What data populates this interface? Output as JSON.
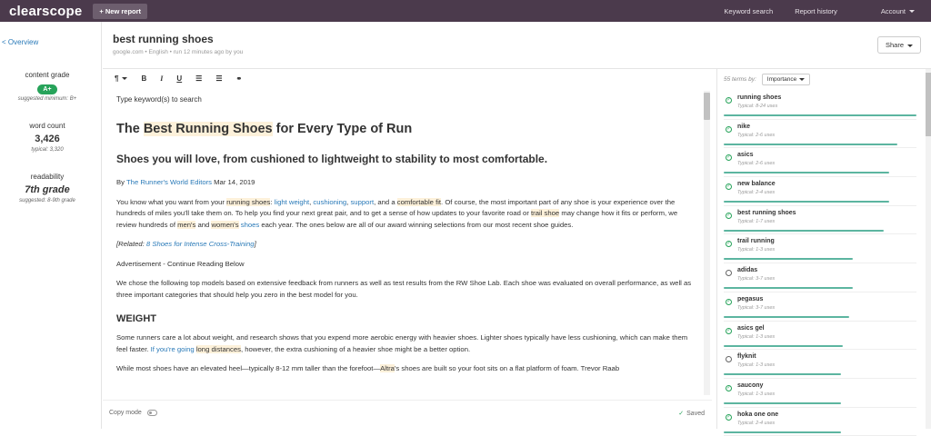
{
  "topbar": {
    "logo": "clearscope",
    "new_report": "+ New report",
    "nav": [
      "Keyword search",
      "Report history",
      "Account"
    ]
  },
  "left": {
    "overview": "< Overview",
    "content_grade_label": "content grade",
    "content_grade": "A+",
    "grade_suggested": "suggested minimum: B+",
    "word_count_label": "word count",
    "word_count": "3,426",
    "word_typical": "typical: 3,320",
    "readability_label": "readability",
    "readability": "7th grade",
    "readability_suggested": "suggested: 8-9th grade"
  },
  "doc": {
    "title": "best running shoes",
    "meta": "google.com • English • run 12 minutes ago by you",
    "share": "Share"
  },
  "toolbar": {
    "para": "¶",
    "bold": "B",
    "italic": "I",
    "underline": "U",
    "ol": "☰",
    "ul": "☰",
    "link": "⚭"
  },
  "editor": {
    "placeholder": "Type keyword(s) to search",
    "h1_pre": "The ",
    "h1_hl": "Best Running Shoes",
    "h1_post": " for Every Type of Run",
    "h2": "Shoes you will love, from cushioned to lightweight to stability to most comfortable.",
    "byline_pre": "By ",
    "byline_link": "The Runner's World Editors",
    "byline_date": " Mar 14, 2019",
    "p1_a": "You know what you want from your ",
    "p1_hl1": "running shoes",
    "p1_b": ": ",
    "p1_l1": "light weight",
    "p1_c": ", ",
    "p1_l2": "cushioning",
    "p1_d": ", ",
    "p1_l3": "support",
    "p1_e": ", and a ",
    "p1_hl2": "comfortable fit",
    "p1_f": ". Of course, the most important part of any shoe is your experience over the hundreds of miles you'll take them on. To help you find your next great pair, and to get a sense of how updates to your favorite road or ",
    "p1_hl3": "trail shoe",
    "p1_g": " may change how it fits or perform, we review hundreds of ",
    "p1_hl4": "men's",
    "p1_h": " and ",
    "p1_hl5": "women's",
    "p1_i": " ",
    "p1_l4": "shoes",
    "p1_j": " each year. The ones below are all of our award winning selections from our most recent shoe guides.",
    "related_pre": "[Related: ",
    "related_link": "8 Shoes for Intense Cross-Training",
    "related_post": "]",
    "ad": "Advertisement - Continue Reading Below",
    "p2": "We chose the following top models based on extensive feedback from runners as well as test results from the RW Shoe Lab. Each shoe was evaluated on overall performance, as well as three important categories that should help you zero in the best model for you.",
    "h3": "WEIGHT",
    "p3_a": "Some runners care a lot about weight, and research shows that you expend more aerobic energy with heavier shoes. Lighter shoes typically have less cushioning, which can make them feel faster. ",
    "p3_l1": "If you're going",
    "p3_b": " ",
    "p3_hl1": "long distances",
    "p3_c": ", however, the extra cushioning of a heavier shoe might be a better option.",
    "p4_a": "While most shoes have an elevated heel—typically 8-12 mm taller than the forefoot—",
    "p4_hl1": "Altra",
    "p4_b": "'s shoes are built so your foot sits on a flat platform of foam. Trevor Raab"
  },
  "footer": {
    "copy_mode": "Copy mode",
    "saved": "Saved"
  },
  "terms": {
    "count_label": "55 terms by:",
    "sort": "Importance",
    "items": [
      {
        "name": "running shoes",
        "typical": "Typical: 8-24 uses",
        "done": true,
        "progress": 1.0
      },
      {
        "name": "nike",
        "typical": "Typical: 2-6 uses",
        "done": true,
        "progress": 0.9
      },
      {
        "name": "asics",
        "typical": "Typical: 2-6 uses",
        "done": true,
        "progress": 0.86
      },
      {
        "name": "new balance",
        "typical": "Typical: 2-4 uses",
        "done": true,
        "progress": 0.86
      },
      {
        "name": "best running shoes",
        "typical": "Typical: 1-7 uses",
        "done": true,
        "progress": 0.83
      },
      {
        "name": "trail running",
        "typical": "Typical: 1-3 uses",
        "done": true,
        "progress": 0.67
      },
      {
        "name": "adidas",
        "typical": "Typical: 3-7 uses",
        "done": false,
        "progress": 0.67
      },
      {
        "name": "pegasus",
        "typical": "Typical: 3-7 uses",
        "done": true,
        "progress": 0.65
      },
      {
        "name": "asics gel",
        "typical": "Typical: 1-3 uses",
        "done": true,
        "progress": 0.62
      },
      {
        "name": "flyknit",
        "typical": "Typical: 1-3 uses",
        "done": false,
        "progress": 0.61
      },
      {
        "name": "saucony",
        "typical": "Typical: 1-3 uses",
        "done": true,
        "progress": 0.61
      },
      {
        "name": "hoka one one",
        "typical": "Typical: 2-4 uses",
        "done": true,
        "progress": 0.61
      }
    ]
  }
}
